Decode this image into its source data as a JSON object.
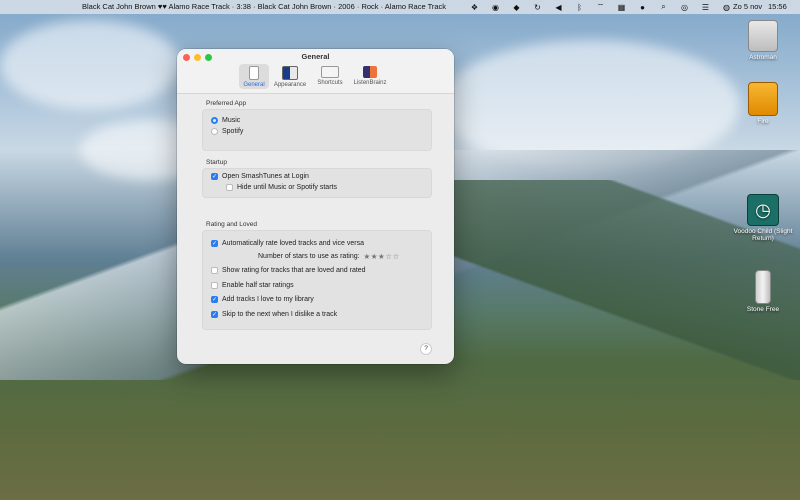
{
  "menubar": {
    "now_playing": "Black Cat John Brown ♥♥ Alamo Race Track · 3:38 · Black Cat John Brown · 2006 · Rock · Alamo Race Track",
    "icons": [
      "dropbox-icon",
      "circle-dot-icon",
      "elephant-icon",
      "sync-icon",
      "speaker-icon",
      "bluetooth-icon",
      "wifi-icon",
      "keyboard-icon",
      "user-icon",
      "search-icon",
      "person-circle-icon",
      "control-center-icon",
      "siri-icon"
    ],
    "date": "Zo 5 nov",
    "time": "15:56"
  },
  "desktop_icons": [
    {
      "label": "Astroman"
    },
    {
      "label": "Fire"
    },
    {
      "label": "Voodoo Child (Slight Return)"
    },
    {
      "label": "Stone Free"
    }
  ],
  "window": {
    "title": "General",
    "tabs": [
      {
        "label": "General",
        "icon": "phone-icon",
        "active": true
      },
      {
        "label": "Appearance",
        "icon": "appearance-icon",
        "active": false
      },
      {
        "label": "Shortcuts",
        "icon": "keyboard-icon",
        "active": false
      },
      {
        "label": "ListenBrainz",
        "icon": "listenbrainz-icon",
        "active": false
      }
    ],
    "preferred_app": {
      "title": "Preferred App",
      "options": [
        {
          "label": "Music",
          "selected": true
        },
        {
          "label": "Spotify",
          "selected": false
        }
      ]
    },
    "startup": {
      "title": "Startup",
      "items": [
        {
          "label": "Open SmashTunes at Login",
          "checked": true
        },
        {
          "label": "Hide until Music or Spotify starts",
          "checked": false
        }
      ]
    },
    "rating": {
      "title": "Rating and Loved",
      "items": [
        {
          "label": "Automatically rate loved tracks and vice versa",
          "checked": true
        },
        {
          "label": "Show rating for tracks that are loved and rated",
          "checked": false
        },
        {
          "label": "Enable half star ratings",
          "checked": false
        },
        {
          "label": "Add tracks I love to my library",
          "checked": true
        },
        {
          "label": "Skip to the next when I dislike a track",
          "checked": true
        }
      ],
      "stars_label": "Number of stars to use as rating:",
      "stars_value": 3,
      "stars_max": 5,
      "stars_glyphs": "★★★☆☆"
    },
    "help_label": "?"
  },
  "colors": {
    "accent": "#2a7df0",
    "close": "#fe5f57",
    "minimize": "#febc2e",
    "zoom": "#28c840"
  }
}
